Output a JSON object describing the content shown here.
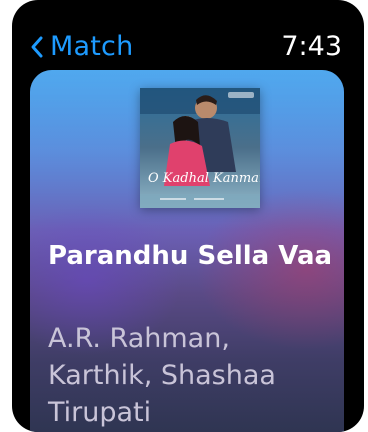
{
  "header": {
    "back_label": "Match",
    "time": "7:43"
  },
  "album": {
    "title_art_text": "O Kadhal Kanmani"
  },
  "song": {
    "title": "Parandhu Sella Vaa",
    "artists": "A.R. Rahman, Karthik, Shashaa Tirupati"
  },
  "colors": {
    "accent": "#1e9bff",
    "background": "#000000",
    "title_text": "#ffffff",
    "artist_text": "#c9c4d8"
  },
  "icons": {
    "back": "chevron-left-icon"
  }
}
